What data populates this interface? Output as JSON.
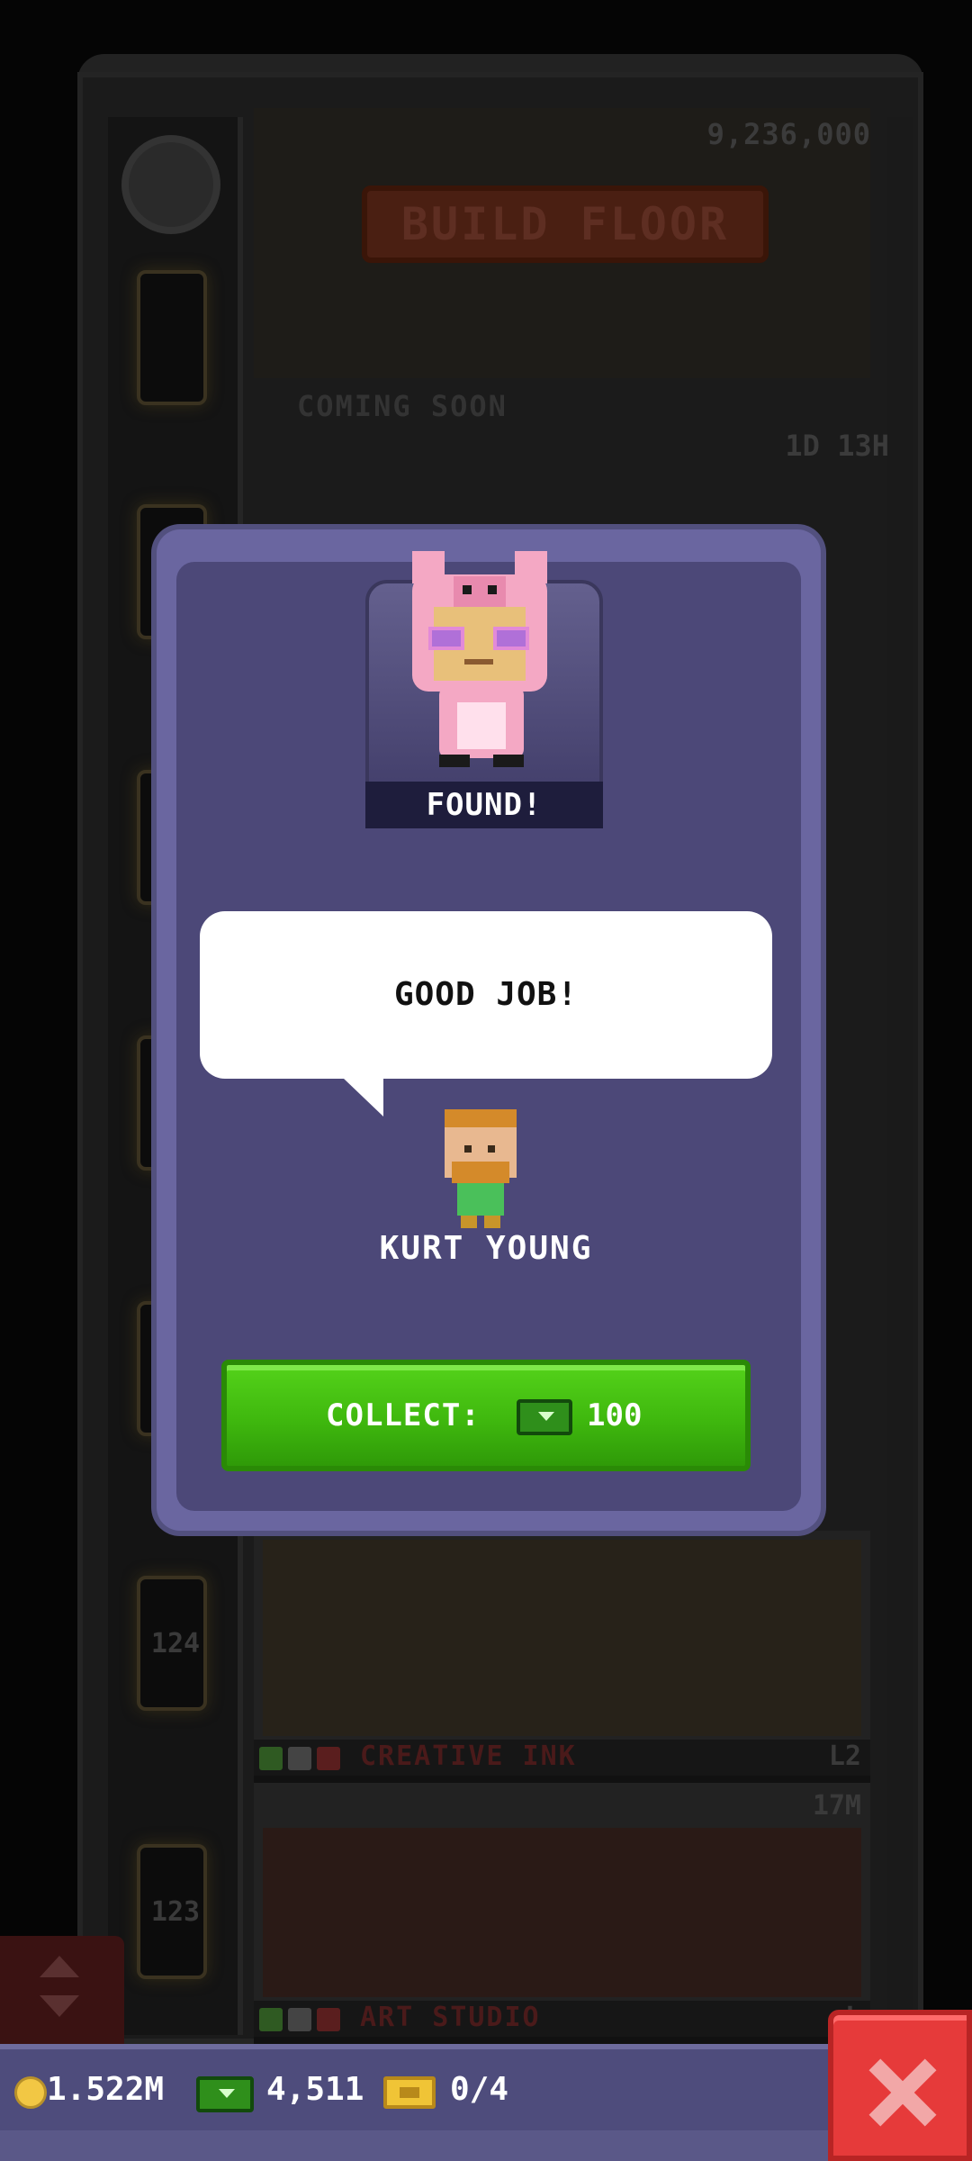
{
  "tower": {
    "build_cost": "9,236,000",
    "build_sign": "BUILD FLOOR",
    "coming_soon": "COMING SOON",
    "timer": "1D 13H",
    "elevator_numbers": [
      "124",
      "123"
    ],
    "floors": [
      {
        "name": "CREATIVE INK",
        "level": "L2",
        "price": "17M"
      },
      {
        "name": "ART STUDIO",
        "level": "L",
        "price": ""
      }
    ]
  },
  "modal": {
    "found_label": "FOUND!",
    "bubble_text": "GOOD JOB!",
    "npc_name": "KURT YOUNG",
    "collect_label": "COLLECT:",
    "collect_amount": "100",
    "collect_icon": "bux-icon"
  },
  "hud": {
    "coins": "1.522M",
    "bux": "4,511",
    "tickets": "0/4",
    "coin_icon": "coin-icon",
    "bux_icon": "bux-icon",
    "ticket_icon": "ticket-icon",
    "close_icon": "close-icon"
  },
  "colors": {
    "modal_frame": "#6a66a0",
    "modal_panel": "#4c4878",
    "collect_green": "#3fb80e",
    "close_red": "#e63a3a"
  }
}
